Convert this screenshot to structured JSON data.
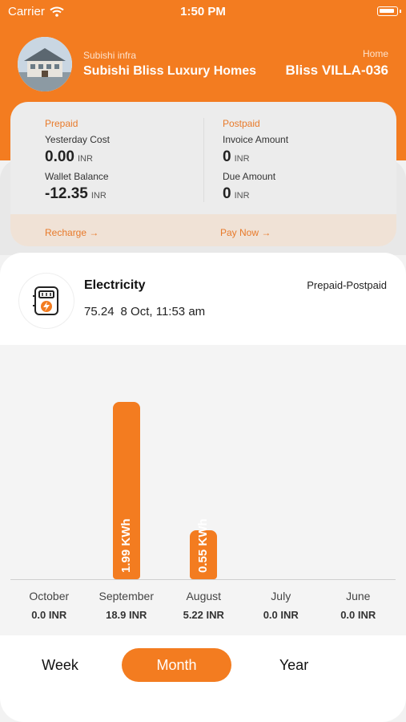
{
  "status": {
    "carrier": "Carrier",
    "time": "1:50 PM"
  },
  "header": {
    "owner": "Subishi infra",
    "project": "Subishi Bliss Luxury Homes",
    "home_label": "Home",
    "unit": "Bliss VILLA-036"
  },
  "summary": {
    "prepaid": {
      "title": "Prepaid",
      "yesterday_label": "Yesterday Cost",
      "yesterday_value": "0.00",
      "wallet_label": "Wallet Balance",
      "wallet_value": "-12.35",
      "currency": "INR",
      "action": "Recharge →"
    },
    "postpaid": {
      "title": "Postpaid",
      "invoice_label": "Invoice Amount",
      "invoice_value": "0",
      "due_label": "Due Amount",
      "due_value": "0",
      "currency": "INR",
      "action": "Pay Now →"
    }
  },
  "meter": {
    "utility": "Electricity",
    "plan": "Prepaid-Postpaid",
    "reading": "75.24",
    "reading_time": "8 Oct, 11:53 am"
  },
  "chart_data": {
    "type": "bar",
    "categories": [
      "October",
      "September",
      "August",
      "July",
      "June"
    ],
    "costs": [
      "0.0 INR",
      "18.9 INR",
      "5.22 INR",
      "0.0 INR",
      "0.0 INR"
    ],
    "values": [
      0,
      1.99,
      0.55,
      0,
      0
    ],
    "data_labels": [
      "",
      "1.99 KWh",
      "0.55 KWh",
      "",
      ""
    ],
    "ylim": [
      0,
      2.0
    ],
    "unit": "KWh",
    "grid": false
  },
  "periods": {
    "week": "Week",
    "month": "Month",
    "year": "Year",
    "selected": "Month"
  },
  "colors": {
    "accent": "#f37c20",
    "accent_text": "#e87a2a"
  }
}
